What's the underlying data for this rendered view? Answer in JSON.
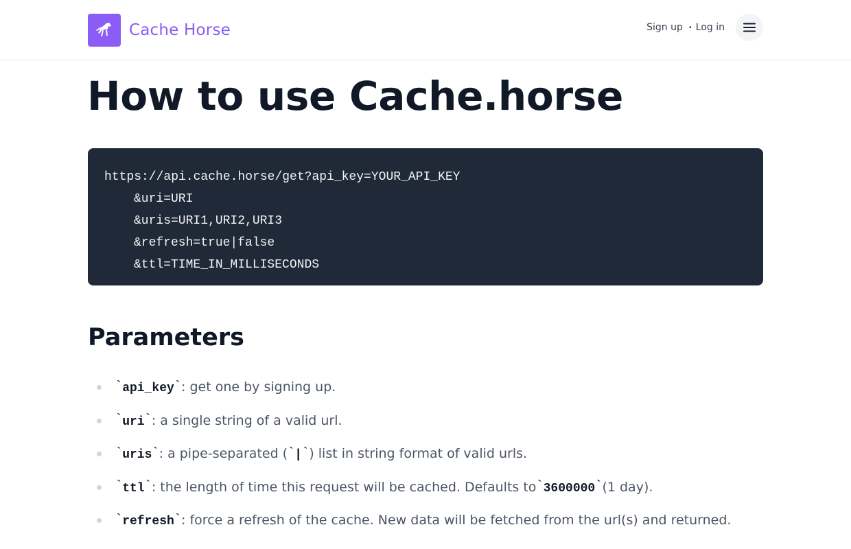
{
  "brand": {
    "name": "Cache Horse",
    "logo_icon": "horse-icon",
    "color": "#8b5cf6"
  },
  "nav": {
    "signup": "Sign up",
    "separator": "•",
    "login": "Log in",
    "menu_icon": "hamburger-menu-icon"
  },
  "page": {
    "title": "How to use Cache.horse"
  },
  "code": {
    "lines": [
      "https://api.cache.horse/get?api_key=YOUR_API_KEY",
      "&uri=URI",
      "&uris=URI1,URI2,URI3",
      "&refresh=true|false",
      "&ttl=TIME_IN_MILLISECONDS"
    ]
  },
  "parameters": {
    "title": "Parameters",
    "tick": "`",
    "items": [
      {
        "name": "api_key",
        "desc": ": get one by signing up."
      },
      {
        "name": "uri",
        "desc": ": a single string of a valid url."
      },
      {
        "name": "uris",
        "desc_a": ": a pipe-separated (",
        "code": "|",
        "desc_b": ") list in string format of valid urls."
      },
      {
        "name": "ttl",
        "desc_a": ": the length of time this request will be cached. Defaults to ",
        "code": "3600000",
        "desc_b": " (1 day)."
      },
      {
        "name": "refresh",
        "desc": ": force a refresh of the cache. New data will be fetched from the url(s) and returned."
      }
    ]
  }
}
